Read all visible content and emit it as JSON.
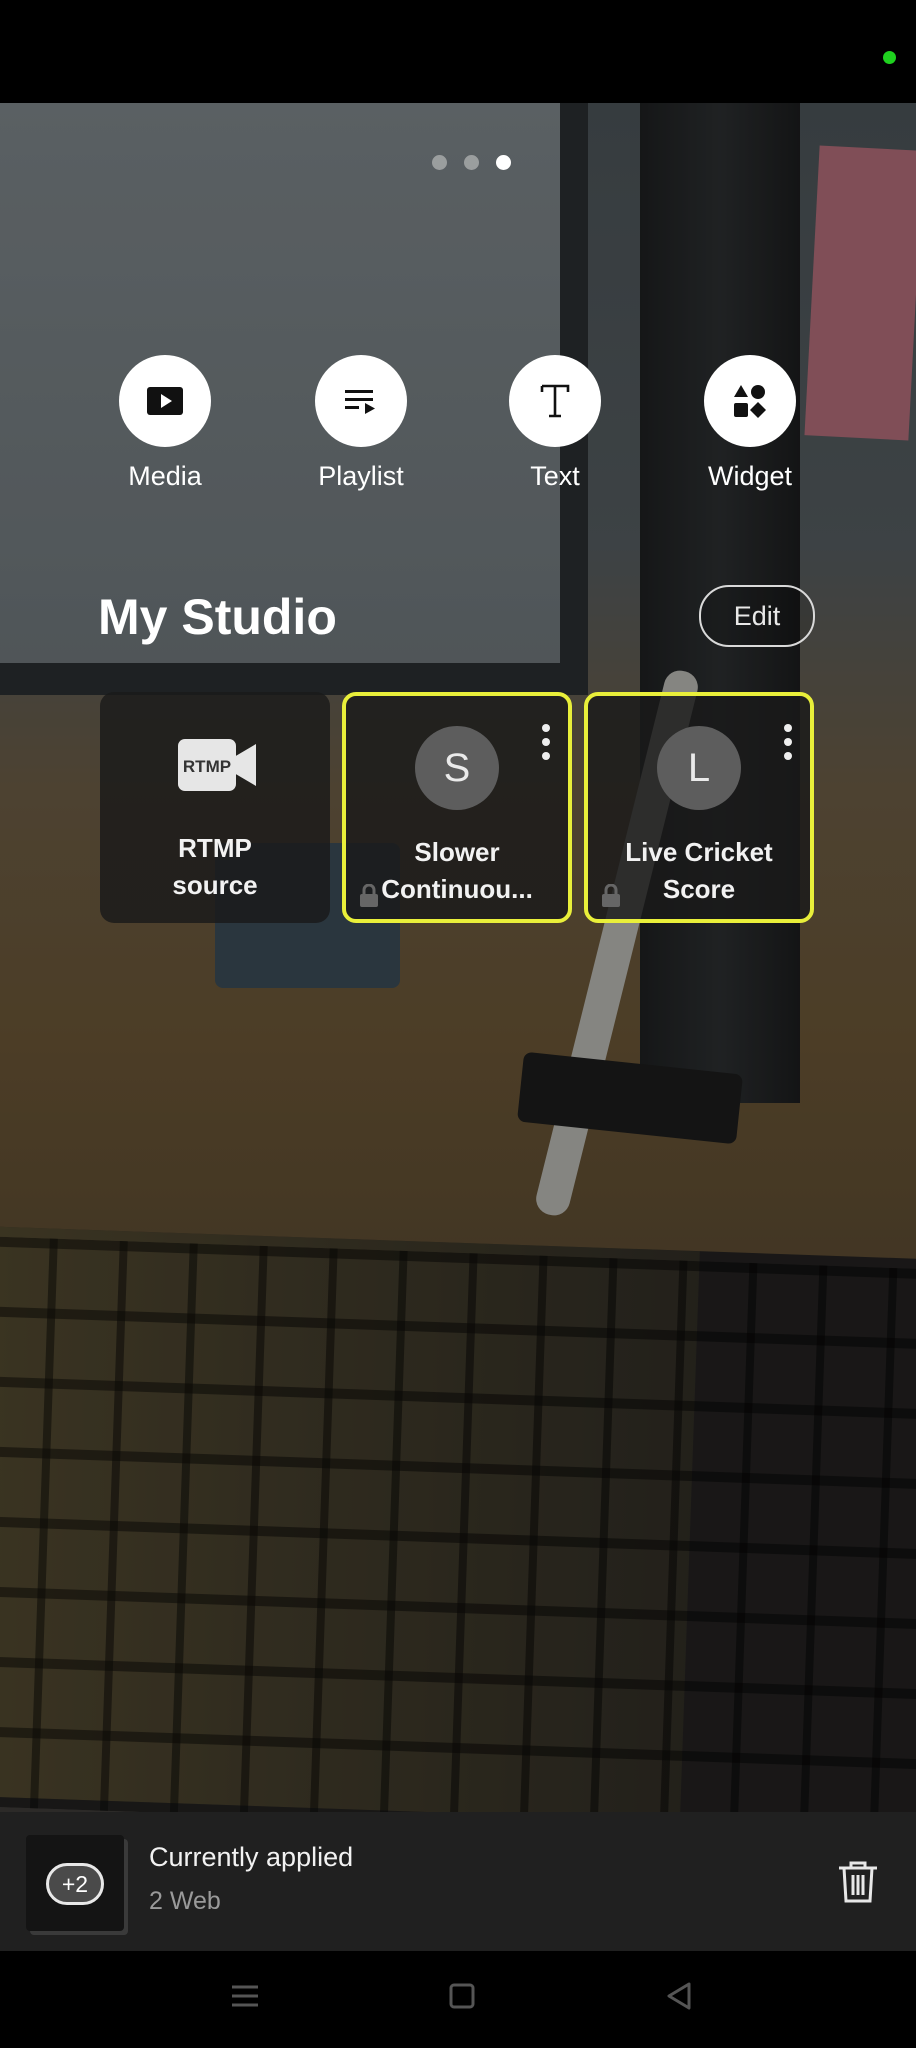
{
  "status_bar": {
    "indicator_color": "#1fd11f"
  },
  "pager": {
    "count": 3,
    "active_index": 2
  },
  "actions": [
    {
      "label": "Media",
      "icon": "play-icon"
    },
    {
      "label": "Playlist",
      "icon": "playlist-icon"
    },
    {
      "label": "Text",
      "icon": "text-icon"
    },
    {
      "label": "Widget",
      "icon": "widget-icon"
    }
  ],
  "studio": {
    "title": "My Studio",
    "edit_label": "Edit",
    "cards": [
      {
        "title_line1": "RTMP",
        "title_line2": "source",
        "logo_text": "RTMP",
        "selected": false
      },
      {
        "avatar": "S",
        "title_line1": "Slower",
        "title_line2": "Continuou...",
        "selected": true,
        "locked": true
      },
      {
        "avatar": "L",
        "title_line1": "Live Cricket",
        "title_line2": "Score",
        "selected": true,
        "locked": true
      }
    ],
    "selected_border_color": "#e9ef3a"
  },
  "applied": {
    "badge": "+2",
    "title": "Currently applied",
    "subtitle": "2 Web"
  }
}
